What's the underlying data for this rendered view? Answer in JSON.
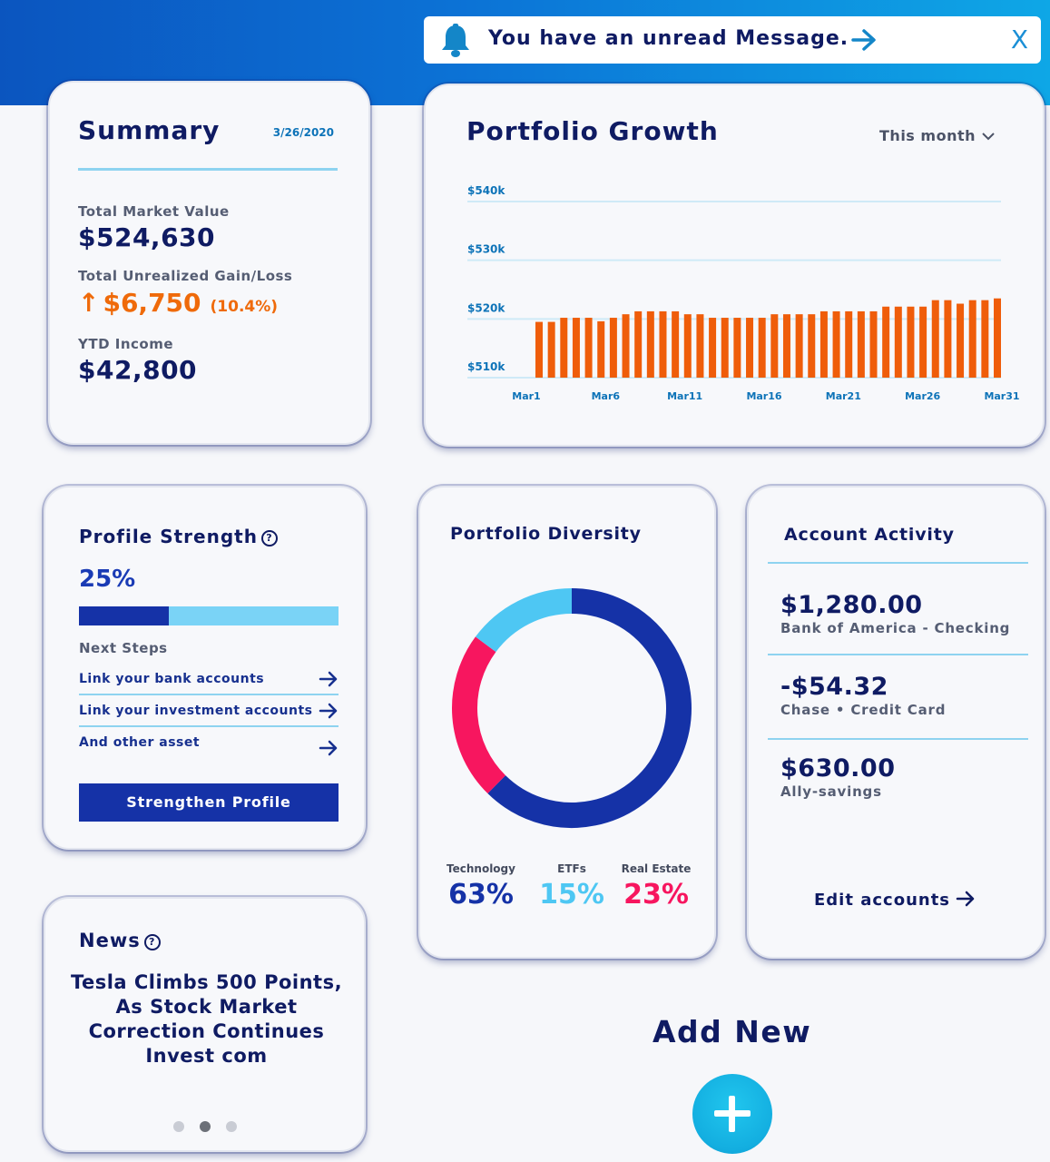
{
  "banner": {
    "message": "You have an unread Message.",
    "close_label": "X",
    "icon": "bell-icon",
    "arrow_icon": "arrow-right-icon"
  },
  "summary": {
    "title": "Summary",
    "date": "3/26/2020",
    "market_value_label": "Total Market Value",
    "market_value": "$524,630",
    "gain_label": "Total Unrealized Gain/Loss",
    "gain_arrow": "↑",
    "gain_value": "$6,750",
    "gain_pct": "(10.4%)",
    "ytd_label": "YTD Income",
    "ytd_value": "$42,800"
  },
  "growth": {
    "title": "Portfolio Growth",
    "period": "This month",
    "period_icon": "chevron-down-icon"
  },
  "chart_data": {
    "type": "bar",
    "title": "Portfolio Growth",
    "y_ticks": [
      {
        "value": 540,
        "label": "$540k"
      },
      {
        "value": 530,
        "label": "$530k"
      },
      {
        "value": 520,
        "label": "$520k"
      },
      {
        "value": 510,
        "label": "$510k"
      }
    ],
    "x_ticks": [
      "Mar1",
      "Mar6",
      "Mar11",
      "Mar16",
      "Mar21",
      "Mar26",
      "Mar31"
    ],
    "ylim": [
      510,
      540
    ],
    "grid": true,
    "bar_color": "#ef5d0a",
    "values": [
      519.5,
      519.5,
      520.2,
      520.2,
      520.2,
      519.6,
      520.2,
      520.8,
      521.3,
      521.3,
      521.3,
      521.3,
      520.8,
      520.8,
      520.2,
      520.2,
      520.2,
      520.2,
      520.2,
      520.8,
      520.8,
      520.8,
      520.8,
      521.3,
      521.3,
      521.3,
      521.3,
      521.3,
      522.1,
      522.1,
      522.1,
      522.1,
      523.2,
      523.2,
      522.6,
      523.2,
      523.2,
      523.5
    ]
  },
  "profile": {
    "title": "Profile Strength",
    "help_icon": "question-circle-icon",
    "percent_label": "25%",
    "percent_value": 0.345,
    "next_steps_label": "Next Steps",
    "steps": [
      {
        "label": "Link your bank accounts"
      },
      {
        "label": "Link your investment accounts"
      },
      {
        "label": "And other asset"
      }
    ],
    "button_label": "Strengthen Profile"
  },
  "diversity": {
    "title": "Portfolio Diversity",
    "segments": [
      {
        "label": "Technology",
        "value_label": "63%",
        "value": 63,
        "color": "#1532a7"
      },
      {
        "label": "ETFs",
        "value_label": "15%",
        "value": 15,
        "color": "#4ec7f3"
      },
      {
        "label": "Real Estate",
        "value_label": "23%",
        "value": 23,
        "color": "#f7165f"
      }
    ]
  },
  "activity": {
    "title": "Account Activity",
    "accounts": [
      {
        "amount": "$1,280.00",
        "name": "Bank of America - Checking"
      },
      {
        "amount": "-$54.32",
        "name": "Chase • Credit Card"
      },
      {
        "amount": "$630.00",
        "name": "Ally-savings"
      }
    ],
    "edit_label": "Edit accounts"
  },
  "news": {
    "title": "News",
    "headline": "Tesla Climbs 500 Points, As Stock Market Correction Continues Invest com",
    "active_dot": 1
  },
  "add_new": {
    "label": "Add New",
    "icon": "plus-icon"
  }
}
